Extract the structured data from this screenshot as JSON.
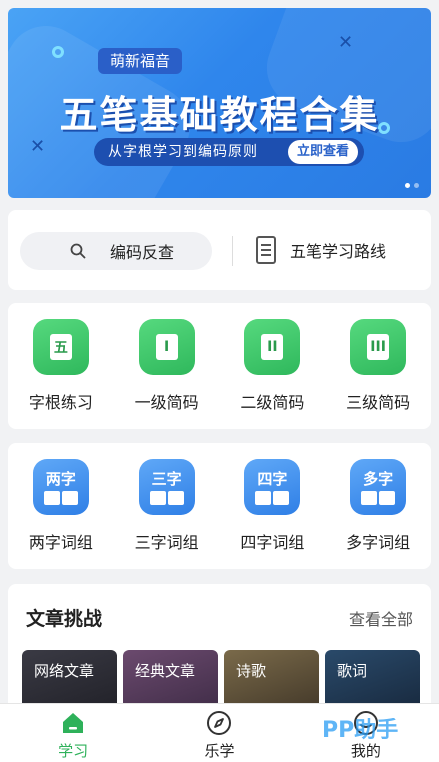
{
  "banner": {
    "tag": "萌新福音",
    "headline": "五笔基础教程合集",
    "subtitle": "从字根学习到编码原则",
    "cta": "立即查看"
  },
  "tools": {
    "search_label": "编码反查",
    "route_label": "五笔学习路线"
  },
  "practice": {
    "items": [
      {
        "glyph": "五",
        "label": "字根练习"
      },
      {
        "glyph": "I",
        "label": "一级简码"
      },
      {
        "glyph": "II",
        "label": "二级简码"
      },
      {
        "glyph": "III",
        "label": "三级简码"
      }
    ]
  },
  "phrases": {
    "items": [
      {
        "glyph": "两字",
        "label": "两字词组"
      },
      {
        "glyph": "三字",
        "label": "三字词组"
      },
      {
        "glyph": "四字",
        "label": "四字词组"
      },
      {
        "glyph": "多字",
        "label": "多字词组"
      }
    ]
  },
  "articles": {
    "title": "文章挑战",
    "more": "查看全部",
    "tiles": [
      "网络文章",
      "经典文章",
      "诗歌",
      "歌词"
    ]
  },
  "tabbar": {
    "items": [
      {
        "label": "学习",
        "icon": "home-icon",
        "active": true
      },
      {
        "label": "乐学",
        "icon": "compass-icon",
        "active": false
      },
      {
        "label": "我的",
        "icon": "profile-icon",
        "active": false
      }
    ]
  },
  "watermark": "PP助手",
  "colors": {
    "accent_green": "#2eb15a",
    "banner_blue": "#2f86ec",
    "tile_blue": "#2f7fe6"
  }
}
